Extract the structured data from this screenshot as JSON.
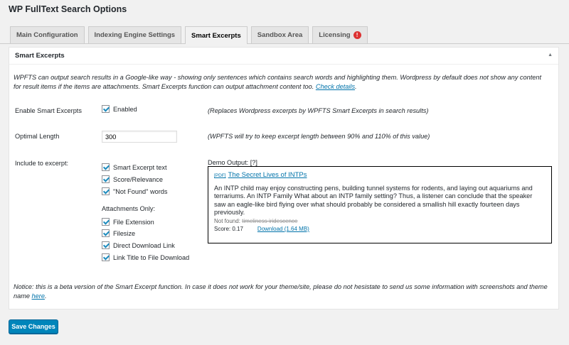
{
  "page": {
    "title": "WP FullText Search Options"
  },
  "tabs": [
    {
      "label": "Main Configuration"
    },
    {
      "label": "Indexing Engine Settings"
    },
    {
      "label": "Smart Excerpts"
    },
    {
      "label": "Sandbox Area"
    },
    {
      "label": "Licensing",
      "badge": "!"
    }
  ],
  "box": {
    "title": "Smart Excerpts",
    "intro": "WPFTS can output search results in a Google-like way - showing only sentences which contains search words and highlighting them. Wordpress by default does not show any content for result items if the items are attachments. Smart Excerpts function can output attachment content too.",
    "intro_link": "Check details",
    "intro_end": ".",
    "enable": {
      "label": "Enable Smart Excerpts",
      "checkbox_label": "Enabled",
      "checked": true,
      "note": "(Replaces Wordpress excerpts by WPFTS Smart Excerpts in search results)"
    },
    "length": {
      "label": "Optimal Length",
      "value": "300",
      "note": "(WPFTS will try to keep excerpt length between 90% and 110% of this value)"
    },
    "include": {
      "label": "Include to excerpt:",
      "options": [
        {
          "label": "Smart Excerpt text",
          "checked": true
        },
        {
          "label": "Score/Relevance",
          "checked": true
        },
        {
          "label": "\"Not Found\" words",
          "checked": true
        }
      ],
      "attachments_label": "Attachments Only:",
      "attachment_options": [
        {
          "label": "File Extension",
          "checked": true
        },
        {
          "label": "Filesize",
          "checked": true
        },
        {
          "label": "Direct Download Link",
          "checked": true
        },
        {
          "label": "Link Title to File Download",
          "checked": true
        }
      ]
    },
    "demo": {
      "label": "Demo Output: [?]",
      "badge": "[PDF]",
      "title": "The Secret Lives of INTPs",
      "text": "An INTP child may enjoy constructing pens, building tunnel systems for rodents, and laying out aquariums and terrariums. An INTP Family What about an INTP family setting? Thus, a listener can conclude that the speaker saw an eagle-like bird flying over what should probably be considered a smallish hill exactly fourteen days previously.",
      "notfound_label": "Not found:",
      "notfound_words": "timeliness iridescence",
      "score": "Score: 0.17",
      "download": "Download (1.64 MB)"
    },
    "notice": "Notice: this is a beta version of the Smart Excerpt function. In case it does not work for your theme/site, please do not hesistate to send us some information with screenshots and theme name",
    "notice_link": "here",
    "notice_end": "."
  },
  "actions": {
    "save": "Save Changes"
  },
  "colors": {
    "accent": "#0085ba",
    "link": "#0073aa",
    "warning": "#dc3232"
  }
}
